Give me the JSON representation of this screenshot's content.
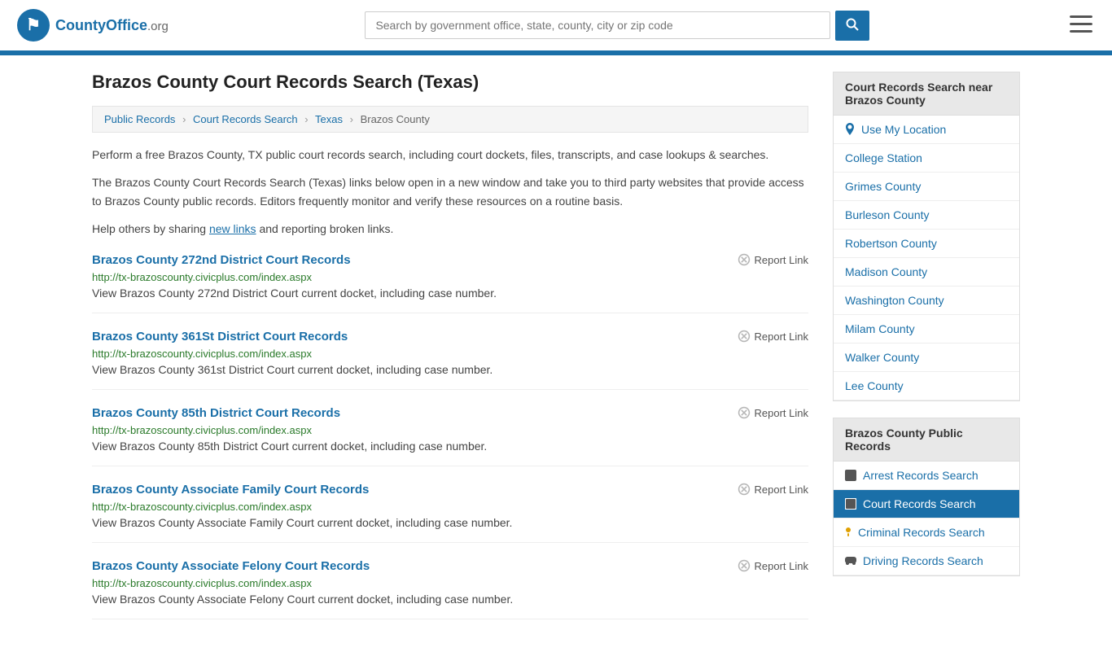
{
  "header": {
    "logo_text": "CountyOffice",
    "logo_suffix": ".org",
    "search_placeholder": "Search by government office, state, county, city or zip code",
    "search_value": ""
  },
  "page": {
    "title": "Brazos County Court Records Search (Texas)"
  },
  "breadcrumb": {
    "items": [
      "Public Records",
      "Court Records Search",
      "Texas",
      "Brazos County"
    ]
  },
  "description": {
    "para1": "Perform a free Brazos County, TX public court records search, including court dockets, files, transcripts, and case lookups & searches.",
    "para2": "The Brazos County Court Records Search (Texas) links below open in a new window and take you to third party websites that provide access to Brazos County public records. Editors frequently monitor and verify these resources on a routine basis.",
    "para3_prefix": "Help others by sharing ",
    "para3_link": "new links",
    "para3_suffix": " and reporting broken links."
  },
  "records": [
    {
      "title": "Brazos County 272nd District Court Records",
      "url": "http://tx-brazoscounty.civicplus.com/index.aspx",
      "desc": "View Brazos County 272nd District Court current docket, including case number.",
      "report_label": "Report Link"
    },
    {
      "title": "Brazos County 361St District Court Records",
      "url": "http://tx-brazoscounty.civicplus.com/index.aspx",
      "desc": "View Brazos County 361st District Court current docket, including case number.",
      "report_label": "Report Link"
    },
    {
      "title": "Brazos County 85th District Court Records",
      "url": "http://tx-brazoscounty.civicplus.com/index.aspx",
      "desc": "View Brazos County 85th District Court current docket, including case number.",
      "report_label": "Report Link"
    },
    {
      "title": "Brazos County Associate Family Court Records",
      "url": "http://tx-brazoscounty.civicplus.com/index.aspx",
      "desc": "View Brazos County Associate Family Court current docket, including case number.",
      "report_label": "Report Link"
    },
    {
      "title": "Brazos County Associate Felony Court Records",
      "url": "http://tx-brazoscounty.civicplus.com/index.aspx",
      "desc": "View Brazos County Associate Felony Court current docket, including case number.",
      "report_label": "Report Link"
    }
  ],
  "sidebar": {
    "nearby_title": "Court Records Search near Brazos County",
    "nearby_links": [
      {
        "label": "Use My Location",
        "icon": "location"
      },
      {
        "label": "College Station",
        "icon": "none"
      },
      {
        "label": "Grimes County",
        "icon": "none"
      },
      {
        "label": "Burleson County",
        "icon": "none"
      },
      {
        "label": "Robertson County",
        "icon": "none"
      },
      {
        "label": "Madison County",
        "icon": "none"
      },
      {
        "label": "Washington County",
        "icon": "none"
      },
      {
        "label": "Milam County",
        "icon": "none"
      },
      {
        "label": "Walker County",
        "icon": "none"
      },
      {
        "label": "Lee County",
        "icon": "none"
      }
    ],
    "public_records_title": "Brazos County Public Records",
    "public_records_links": [
      {
        "label": "Arrest Records Search",
        "icon": "square",
        "active": false
      },
      {
        "label": "Court Records Search",
        "icon": "building",
        "active": true
      },
      {
        "label": "Criminal Records Search",
        "icon": "exclamation",
        "active": false
      },
      {
        "label": "Driving Records Search",
        "icon": "car",
        "active": false
      }
    ]
  }
}
